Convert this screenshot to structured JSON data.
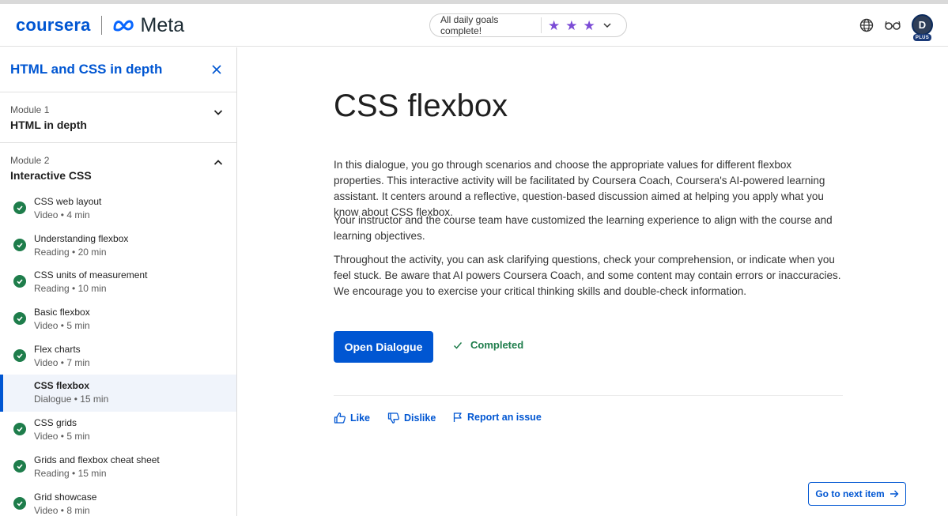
{
  "header": {
    "coursera_logo": "coursera",
    "meta_logo": "Meta",
    "goals_text": "All daily goals complete!",
    "stars": [
      "★",
      "★",
      "★"
    ],
    "avatar_initial": "D",
    "avatar_badge": "PLUS"
  },
  "sidebar": {
    "course_title": "HTML and CSS in depth",
    "modules": [
      {
        "label": "Module 1",
        "name": "HTML in depth",
        "expanded": false
      },
      {
        "label": "Module 2",
        "name": "Interactive CSS",
        "expanded": true
      }
    ],
    "items": [
      {
        "title": "CSS web layout",
        "meta": "Video • 4 min",
        "completed": true
      },
      {
        "title": "Understanding flexbox",
        "meta": "Reading • 20 min",
        "completed": true
      },
      {
        "title": "CSS units of measurement",
        "meta": "Reading • 10 min",
        "completed": true
      },
      {
        "title": "Basic flexbox",
        "meta": "Video • 5 min",
        "completed": true
      },
      {
        "title": "Flex charts",
        "meta": "Video • 7 min",
        "completed": true
      },
      {
        "title": "CSS flexbox",
        "meta": "Dialogue • 15 min",
        "completed": false,
        "selected": true
      },
      {
        "title": "CSS grids",
        "meta": "Video • 5 min",
        "completed": true
      },
      {
        "title": "Grids and flexbox cheat sheet",
        "meta": "Reading • 15 min",
        "completed": true
      },
      {
        "title": "Grid showcase",
        "meta": "Video • 8 min",
        "completed": true
      }
    ]
  },
  "main": {
    "title": "CSS flexbox",
    "paragraphs": [
      "In this dialogue, you go through scenarios and choose the appropriate values for different flexbox properties. This interactive activity will be facilitated by Coursera Coach, Coursera's AI-powered learning assistant. It centers around a reflective, question-based discussion aimed at helping you apply what you know about CSS flexbox.",
      "Your instructor and the course team have customized the learning experience to align with the course and learning objectives.",
      "Throughout the activity, you can ask clarifying questions, check your comprehension, or indicate when you feel stuck. Be aware that AI powers Coursera Coach, and some content may contain errors or inaccuracies. We encourage you to exercise your critical thinking skills and double-check information."
    ],
    "open_button": "Open Dialogue",
    "status": "Completed",
    "like": "Like",
    "dislike": "Dislike",
    "report": "Report an issue",
    "next_button": "Go to next item"
  },
  "colors": {
    "brand_blue": "#0056d2",
    "success_green": "#1e7d4b",
    "star_purple": "#7b4bd6"
  },
  "icons": {
    "globe": "globe-icon",
    "accessibility": "glasses-icon",
    "close": "close-icon",
    "check": "check-circle-icon"
  }
}
